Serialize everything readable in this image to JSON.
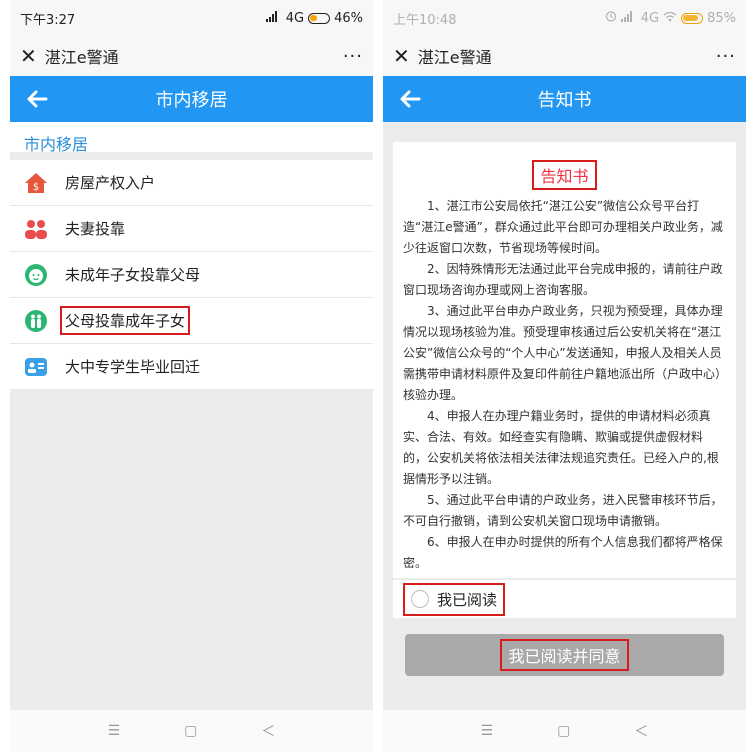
{
  "left": {
    "status": {
      "time": "下午3:27",
      "network": "4G",
      "battery": "46%",
      "battery_level": 0.46
    },
    "wechat": {
      "title": "湛江e警通",
      "close": "✕",
      "more": "···"
    },
    "appbar": {
      "title": "市内移居"
    },
    "section_title": "市内移居",
    "menu": [
      {
        "label": "房屋产权入户",
        "icon": "house-dollar-icon"
      },
      {
        "label": "夫妻投靠",
        "icon": "couple-icon"
      },
      {
        "label": "未成年子女投靠父母",
        "icon": "baby-face-icon"
      },
      {
        "label": "父母投靠成年子女",
        "icon": "family-icon"
      },
      {
        "label": "大中专学生毕业回迁",
        "icon": "student-card-icon"
      }
    ]
  },
  "right": {
    "status": {
      "time": "上午10:48",
      "network": "4G",
      "battery": "85%",
      "battery_level": 0.85
    },
    "wechat": {
      "title": "湛江e警通",
      "close": "✕",
      "more": "···"
    },
    "appbar": {
      "title": "告知书"
    },
    "notice": {
      "title": "告知书",
      "paragraphs": [
        "1、湛江市公安局依托“湛江公安”微信公众号平台打造“湛江e警通”，群众通过此平台即可办理相关户政业务，减少往返窗口次数，节省现场等候时间。",
        "2、因特殊情形无法通过此平台完成申报的，请前往户政窗口现场咨询办理或网上咨询客服。",
        "3、通过此平台申办户政业务，只视为预受理，具体办理情况以现场核验为准。预受理审核通过后公安机关将在“湛江公安”微信公众号的“个人中心”发送通知，申报人及相关人员需携带申请材料原件及复印件前往户籍地派出所（户政中心）核验办理。",
        "4、申报人在办理户籍业务时，提供的申请材料必须真实、合法、有效。如经查实有隐瞒、欺骗或提供虚假材料的，公安机关将依法相关法律法规追究责任。已经入户的,根据情形予以注销。",
        "5、通过此平台申请的户政业务，进入民警审核环节后，不可自行撤销，请到公安机关窗口现场申请撤销。",
        "6、申报人在申办时提供的所有个人信息我们都将严格保密。"
      ]
    },
    "read_checkbox_label": "我已阅读",
    "agree_button_label": "我已阅读并同意"
  },
  "nav": {
    "menu": "☰",
    "home": "▢",
    "back": "＜"
  },
  "colors": {
    "appbar": "#2196f3",
    "section_text": "#2a8fd8",
    "highlight": "#d81b1b",
    "title_red": "#ee3344",
    "button_disabled": "#a9a9a9"
  }
}
